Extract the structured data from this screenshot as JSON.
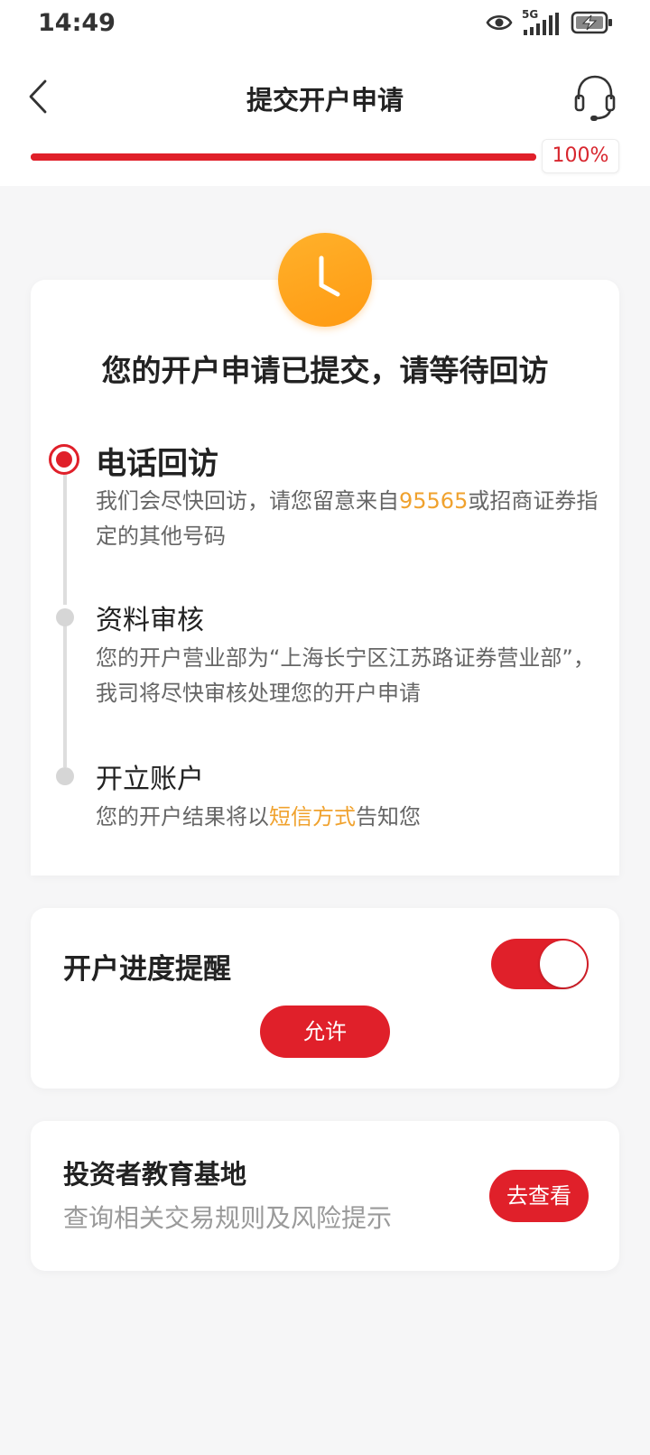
{
  "status_bar": {
    "time": "14:49",
    "network": "5G",
    "icons": [
      "eye-icon",
      "signal-icon",
      "battery-charging-icon"
    ]
  },
  "nav": {
    "title": "提交开户申请",
    "back_icon": "chevron-left-icon",
    "service_icon": "headset-icon"
  },
  "progress": {
    "value": 1.0,
    "label": "100%"
  },
  "status_card": {
    "icon": "clock-icon",
    "headline": "您的开户申请已提交，请等待回访",
    "steps": [
      {
        "title": "电话回访",
        "state": "active",
        "desc_prefix": "我们会尽快回访，请您留意来自",
        "desc_highlight": "95565",
        "desc_suffix": "或招商证券指定的其他号码"
      },
      {
        "title": "资料审核",
        "state": "pending",
        "desc": "您的开户营业部为“上海长宁区江苏路证券营业部”，我司将尽快审核处理您的开户申请"
      },
      {
        "title": "开立账户",
        "state": "pending",
        "desc_prefix": "您的开户结果将以",
        "desc_highlight": "短信方式",
        "desc_suffix": "告知您"
      }
    ]
  },
  "reminder": {
    "title": "开户进度提醒",
    "toggle_on": true,
    "allow_label": "允许"
  },
  "education": {
    "title": "投资者教育基地",
    "subtitle": "查询相关交易规则及风险提示",
    "button_label": "去查看"
  },
  "colors": {
    "accent": "#e0202a",
    "highlight": "#f0a22e",
    "clock": "#ffa41f"
  }
}
